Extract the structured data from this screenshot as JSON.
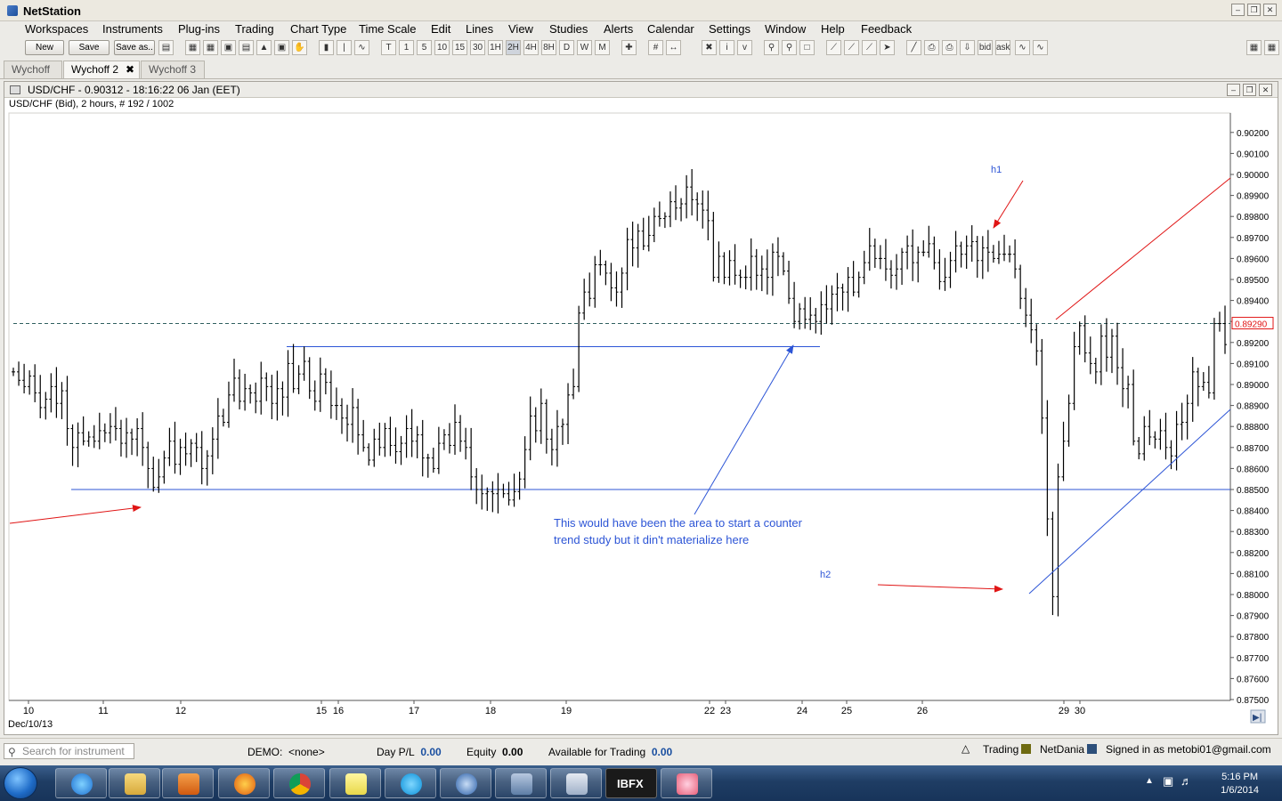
{
  "app": {
    "title": "NetStation"
  },
  "menu": [
    "Workspaces",
    "Instruments",
    "Plug-ins",
    "Trading",
    "Chart Type",
    "Time Scale",
    "Edit",
    "Lines",
    "View",
    "Studies",
    "Alerts",
    "Calendar",
    "Settings",
    "Window",
    "Help",
    "Feedback"
  ],
  "toolbar": {
    "new_label": "New",
    "save_label": "Save",
    "saveas_label": "Save as..",
    "timeframes": [
      "T",
      "1",
      "5",
      "10",
      "15",
      "30",
      "1H",
      "2H",
      "4H",
      "8H",
      "D",
      "W",
      "M"
    ],
    "active_timeframe": "2H",
    "bid_label": "bid",
    "ask_label": "ask"
  },
  "tabs": [
    {
      "label": "Wychoff",
      "active": false
    },
    {
      "label": "Wychoff 2",
      "active": true
    },
    {
      "label": "Wychoff 3",
      "active": false
    }
  ],
  "chart_window": {
    "title": "USD/CHF - 0.90312 - 18:16:22  06 Jan (EET)",
    "subtitle": "USD/CHF (Bid), 2 hours, # 192 / 1002"
  },
  "chart_data": {
    "type": "ohlc",
    "instrument": "USD/CHF",
    "ylim": [
      0.875,
      0.9025
    ],
    "y_ticks": [
      "0.90200",
      "0.90100",
      "0.90000",
      "0.89900",
      "0.89800",
      "0.89700",
      "0.89600",
      "0.89500",
      "0.89400",
      "0.89300",
      "0.89200",
      "0.89100",
      "0.89000",
      "0.88900",
      "0.88800",
      "0.88700",
      "0.88600",
      "0.88500",
      "0.88400",
      "0.88300",
      "0.88200",
      "0.88100",
      "0.88000",
      "0.87900",
      "0.87800",
      "0.87700",
      "0.87600",
      "0.87500"
    ],
    "x_ticks": [
      "10",
      "11",
      "12",
      "15",
      "16",
      "17",
      "18",
      "19",
      "22",
      "23",
      "24",
      "25",
      "26",
      "29",
      "30"
    ],
    "x_start_label": "Dec/10/13",
    "current_price_label": "0.89290",
    "current_price": 0.8929,
    "horizontal_lines": [
      0.8918,
      0.885
    ],
    "annotations": {
      "h1": "h1",
      "h2": "h2",
      "note_line1": "This would have been the area to start a counter",
      "note_line2": "trend study but it din't materialize here"
    },
    "colors": {
      "bars": "#000000",
      "support_line": "#2d55d6",
      "arrow": "#e01515",
      "note": "#2d55d6",
      "price_line": "#2f5f5f"
    },
    "closes": [
      0.8906,
      0.8902,
      0.8899,
      0.8904,
      0.8896,
      0.8889,
      0.8893,
      0.8899,
      0.8891,
      0.8897,
      0.8879,
      0.887,
      0.8877,
      0.8873,
      0.8875,
      0.8873,
      0.8878,
      0.8877,
      0.888,
      0.8879,
      0.8872,
      0.8877,
      0.8874,
      0.8879,
      0.887,
      0.886,
      0.8851,
      0.8856,
      0.8865,
      0.8873,
      0.8862,
      0.887,
      0.8867,
      0.8872,
      0.887,
      0.886,
      0.8866,
      0.8874,
      0.8885,
      0.8882,
      0.8895,
      0.8903,
      0.8892,
      0.8898,
      0.8896,
      0.8892,
      0.8903,
      0.8899,
      0.8891,
      0.8898,
      0.8894,
      0.891,
      0.8898,
      0.8905,
      0.8911,
      0.8897,
      0.8892,
      0.8905,
      0.8901,
      0.889,
      0.889,
      0.8884,
      0.8881,
      0.8889,
      0.8876,
      0.887,
      0.8864,
      0.8874,
      0.887,
      0.8879,
      0.8871,
      0.8868,
      0.8872,
      0.8879,
      0.8873,
      0.8876,
      0.8865,
      0.8865,
      0.886,
      0.8872,
      0.8876,
      0.8871,
      0.8882,
      0.8873,
      0.887,
      0.8856,
      0.885,
      0.8848,
      0.8849,
      0.8848,
      0.885,
      0.8848,
      0.8845,
      0.8849,
      0.8855,
      0.8869,
      0.8885,
      0.8878,
      0.8891,
      0.8874,
      0.8869,
      0.888,
      0.8881,
      0.8895,
      0.8899,
      0.8934,
      0.8944,
      0.8941,
      0.8957,
      0.8957,
      0.8953,
      0.8946,
      0.8944,
      0.8953,
      0.8969,
      0.8965,
      0.8973,
      0.8966,
      0.8971,
      0.898,
      0.8979,
      0.898,
      0.8987,
      0.8984,
      0.8986,
      0.8994,
      0.8988,
      0.8986,
      0.8983,
      0.8978,
      0.8951,
      0.8961,
      0.8951,
      0.8959,
      0.8952,
      0.8951,
      0.8951,
      0.8961,
      0.8952,
      0.8955,
      0.8951,
      0.8963,
      0.8961,
      0.8954,
      0.8941,
      0.893,
      0.8936,
      0.8931,
      0.8933,
      0.893,
      0.8938,
      0.8936,
      0.8943,
      0.8946,
      0.8944,
      0.8951,
      0.8944,
      0.8951,
      0.8958,
      0.8966,
      0.896,
      0.896,
      0.8955,
      0.8952,
      0.8955,
      0.8963,
      0.8966,
      0.8958,
      0.8963,
      0.8963,
      0.8967,
      0.8958,
      0.8949,
      0.8951,
      0.8959,
      0.8966,
      0.8962,
      0.8966,
      0.8968,
      0.8959,
      0.8965,
      0.8963,
      0.896,
      0.8962,
      0.8962,
      0.8962,
      0.8955,
      0.8941,
      0.8933,
      0.8926,
      0.8916,
      0.8884,
      0.8836,
      0.8799,
      0.8856,
      0.8873,
      0.8891,
      0.8918,
      0.8928,
      0.8915,
      0.891,
      0.8906,
      0.8923,
      0.8913,
      0.8923,
      0.8908,
      0.8898,
      0.89,
      0.8873,
      0.8867,
      0.888,
      0.8875,
      0.8874,
      0.8878,
      0.887,
      0.8866,
      0.8881,
      0.8882,
      0.8891,
      0.8906,
      0.8899,
      0.8901,
      0.8896,
      0.8929,
      0.8929,
      0.8919
    ]
  },
  "status": {
    "search_placeholder": "Search for instrument",
    "demo_label": "DEMO:",
    "demo_value": "<none>",
    "daypl_label": "Day P/L",
    "daypl_value": "0.00",
    "equity_label": "Equity",
    "equity_value": "0.00",
    "avail_label": "Available for Trading",
    "avail_value": "0.00",
    "trading_label": "Trading",
    "netdania_label": "NetDania",
    "signed_label": "Signed in as metobi01@gmail.com"
  },
  "taskbar": {
    "time": "5:16 PM",
    "date": "1/6/2014",
    "ibfx_label": "IBFX"
  }
}
